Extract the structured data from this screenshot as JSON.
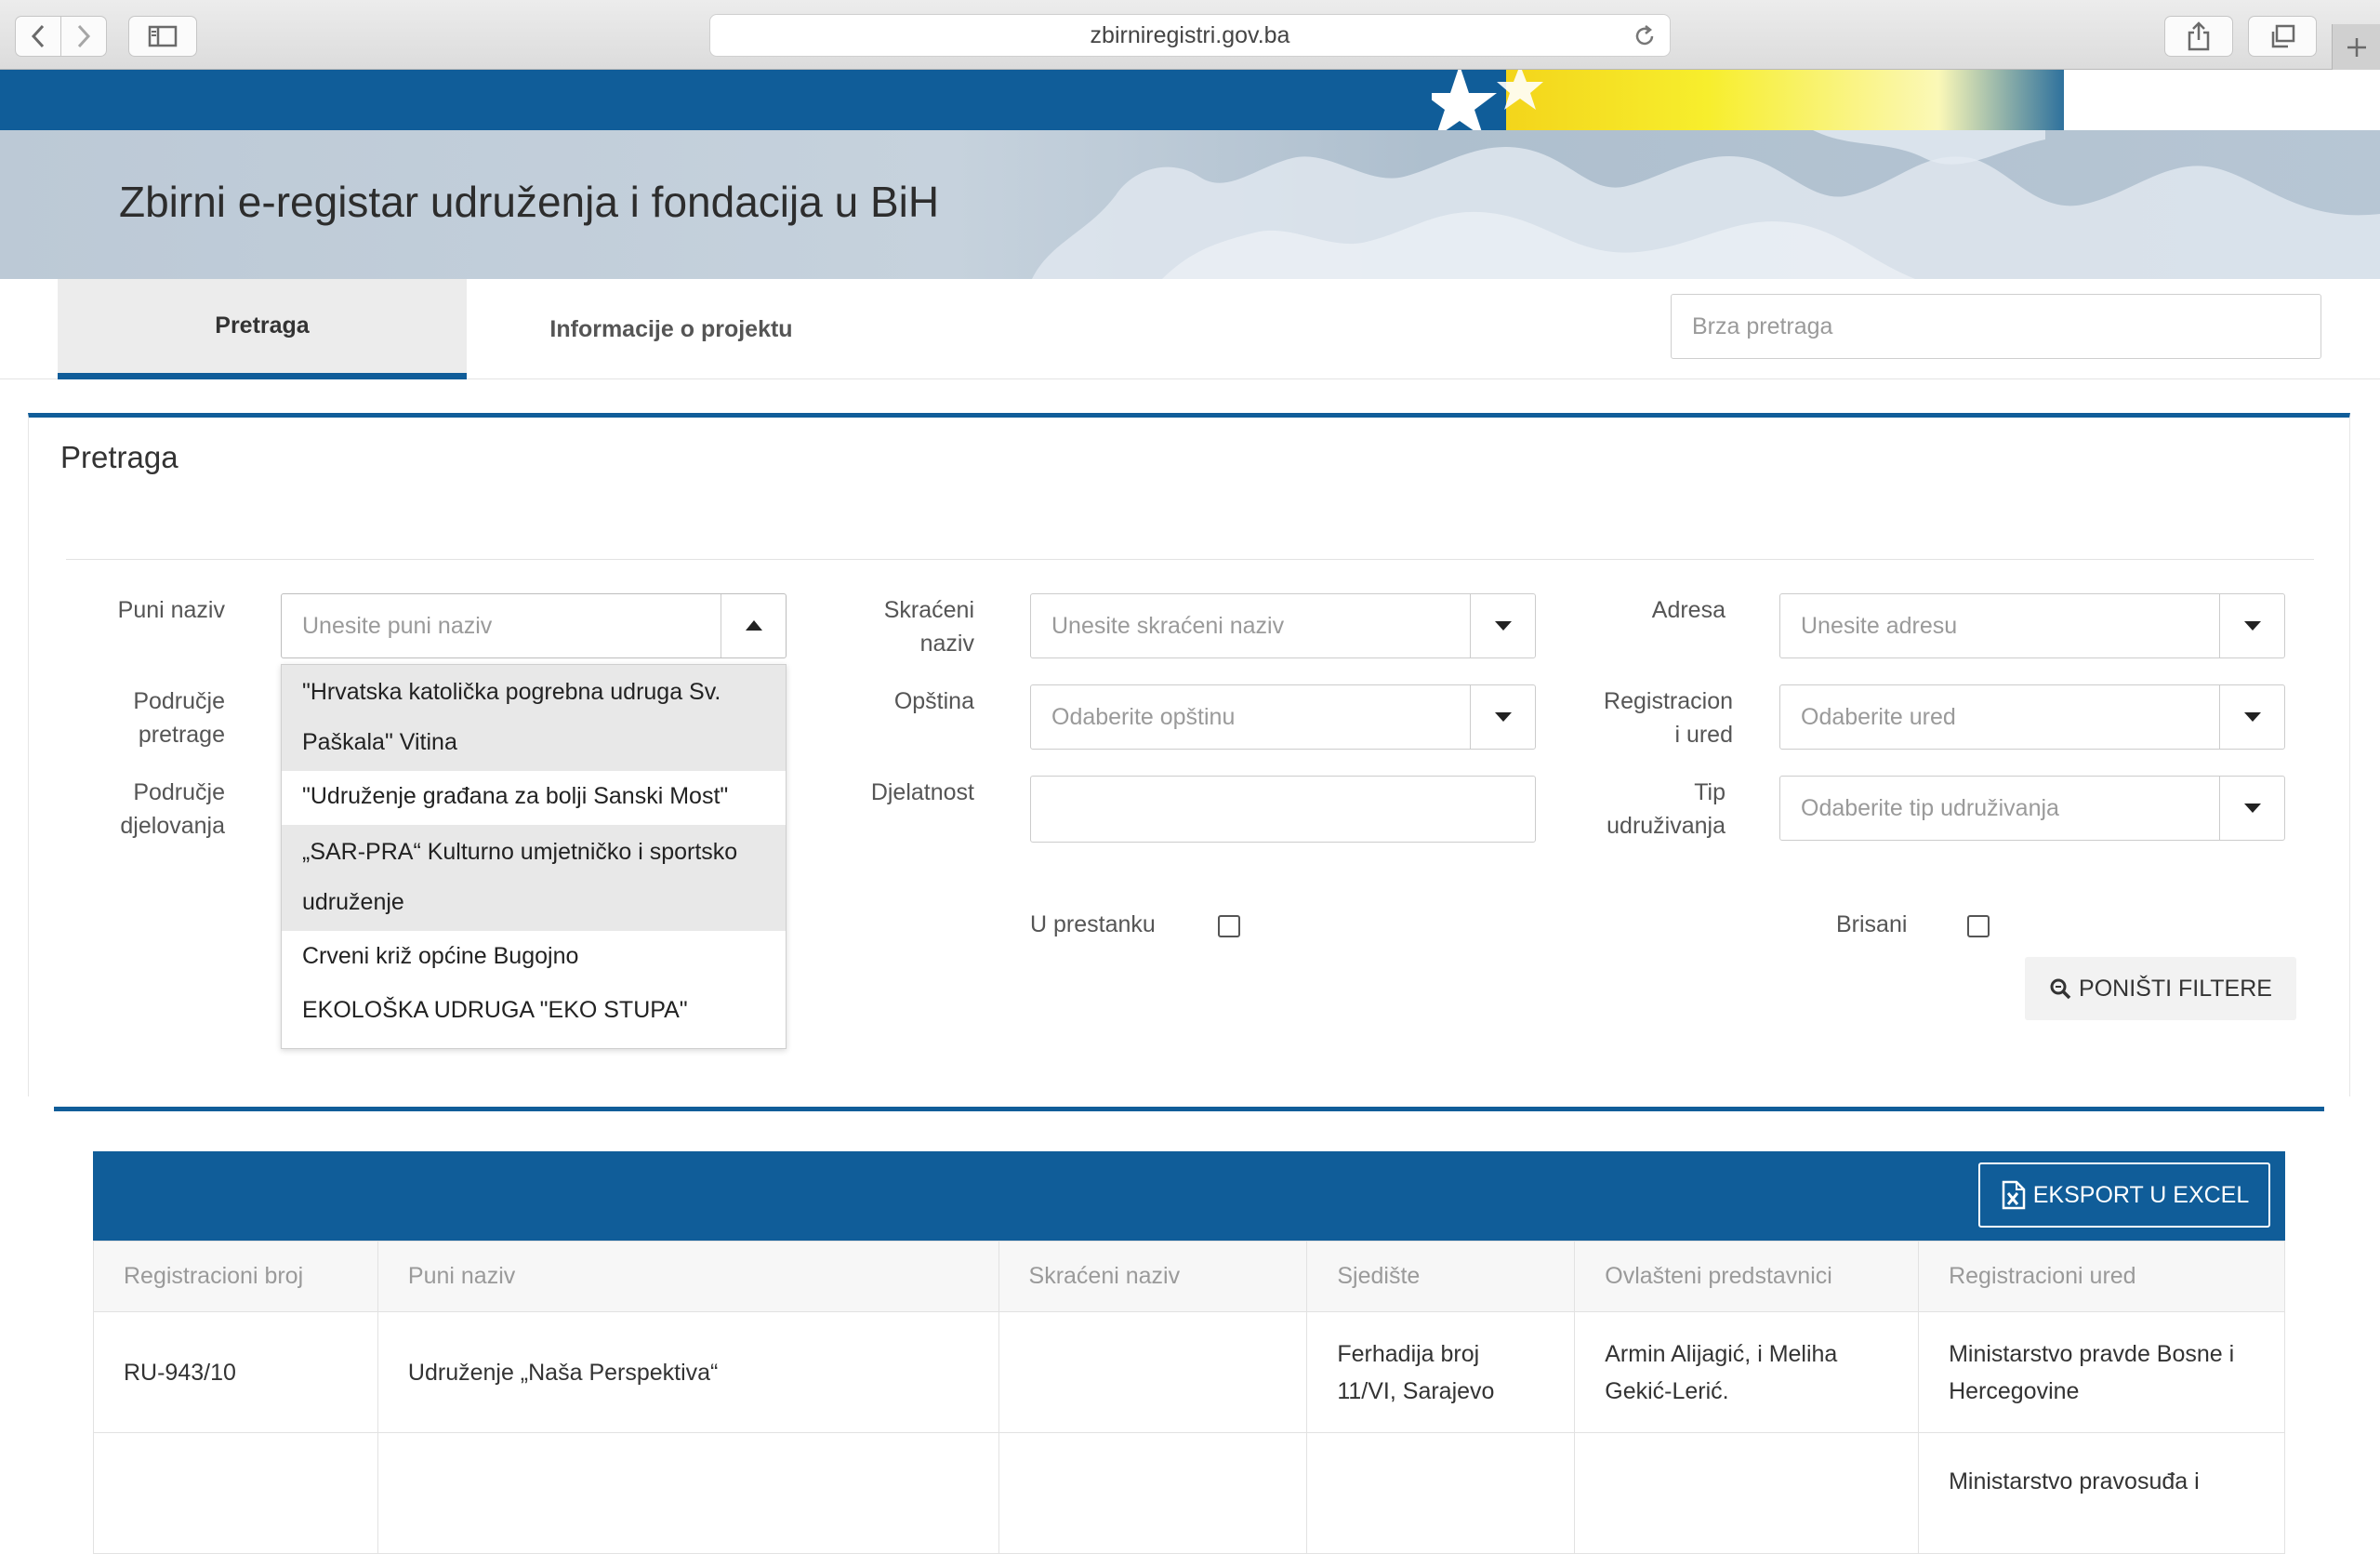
{
  "browser": {
    "url": "zbirniregistri.gov.ba"
  },
  "header": {
    "title": "Zbirni e-registar udruženja i fondacija u BiH"
  },
  "nav": {
    "tabs": [
      {
        "label": "Pretraga",
        "active": true
      },
      {
        "label": "Informacije o projektu",
        "active": false
      }
    ],
    "quick_search_placeholder": "Brza pretraga"
  },
  "search": {
    "title": "Pretraga",
    "fields": {
      "puni_naziv": {
        "label": "Puni naziv",
        "placeholder": "Unesite puni naziv"
      },
      "podrucje_pretrage": {
        "label_line1": "Područje",
        "label_line2": "pretrage"
      },
      "podrucje_djelovanja": {
        "label_line1": "Područje",
        "label_line2": "djelovanja"
      },
      "skraceni_naziv": {
        "label_line1": "Skraćeni",
        "label_line2": "naziv",
        "placeholder": "Unesite skraćeni naziv"
      },
      "opstina": {
        "label": "Opština",
        "placeholder": "Odaberite opštinu"
      },
      "djelatnost": {
        "label": "Djelatnost",
        "value": ""
      },
      "adresa": {
        "label": "Adresa",
        "placeholder": "Unesite adresu"
      },
      "registracioni_ured": {
        "label_line1": "Registracion",
        "label_line2": "i ured",
        "placeholder": "Odaberite ured"
      },
      "tip": {
        "label_line1": "Tip",
        "label_line2": "udruživanja",
        "placeholder": "Odaberite tip udruživanja"
      }
    },
    "dropdown_options": [
      {
        "line1": "\"Hrvatska katolička pogrebna udruga Sv.",
        "line2": "Paškala\" Vitina"
      },
      {
        "line1": "\"Udruženje građana za bolji Sanski Most\"",
        "line2": ""
      },
      {
        "line1": "„SAR-PRA“ Kulturno umjetničko i sportsko",
        "line2": "udruženje"
      },
      {
        "line1": "Crveni križ općine Bugojno",
        "line2": ""
      },
      {
        "line1": "EKOLOŠKA UDRUGA \"EKO STUPA\"",
        "line2": ""
      }
    ],
    "u_prestanku_label": "U prestanku",
    "u_prestanku_checked": false,
    "brisani_label": "Brisani",
    "brisani_checked": false,
    "reset_label": "PONIŠTI FILTERE"
  },
  "results": {
    "export_label": "EKSPORT U EXCEL",
    "columns": [
      "Registracioni broj",
      "Puni naziv",
      "Skraćeni naziv",
      "Sjedište",
      "Ovlašteni predstavnici",
      "Registracioni ured"
    ],
    "rows": [
      {
        "reg_broj": "RU-943/10",
        "puni_naziv": "Udruženje „Naša Perspektiva“",
        "skraceni_naziv": "",
        "sjediste_line1": "Ferhadija broj",
        "sjediste_line2": "11/VI, Sarajevo",
        "predstavnici_line1": "Armin Alijagić, i Meliha",
        "predstavnici_line2": "Gekić-Lerić.",
        "ured_line1": "Ministarstvo pravde Bosne i",
        "ured_line2": "Hercegovine"
      },
      {
        "reg_broj": "",
        "puni_naziv": "",
        "skraceni_naziv": "",
        "sjediste_line1": "",
        "sjediste_line2": "",
        "predstavnici_line1": "",
        "predstavnici_line2": "",
        "ured_line1": "Ministarstvo pravosuđa i",
        "ured_line2": ""
      }
    ]
  }
}
